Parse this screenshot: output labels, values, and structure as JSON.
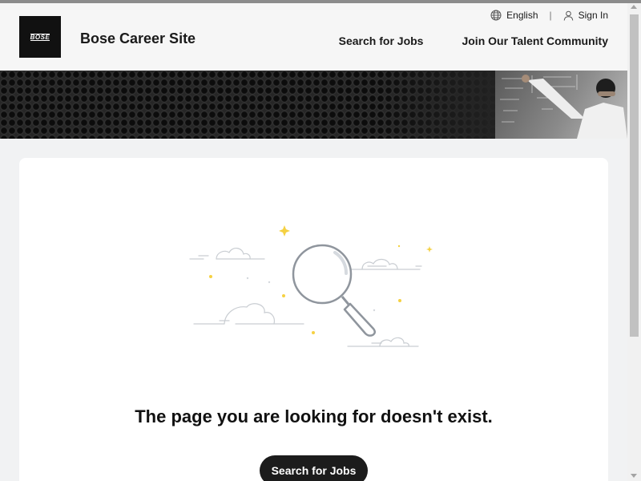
{
  "header": {
    "logo_text": "BOSE",
    "site_title": "Bose Career Site",
    "language_label": "English",
    "sign_in_label": "Sign In",
    "separator": "|",
    "nav": {
      "search_jobs": "Search for Jobs",
      "talent_community": "Join Our Talent Community"
    }
  },
  "main": {
    "message": "The page you are looking for doesn't exist.",
    "cta_label": "Search for Jobs"
  },
  "colors": {
    "header_bg": "#f6f6f6",
    "page_bg": "#f1f2f3",
    "card_bg": "#ffffff",
    "button_bg": "#1c1c1c",
    "sparkle": "#f5d142",
    "illustration_stroke": "#9aa0a8"
  },
  "icons": {
    "language": "globe-icon",
    "sign_in": "user-icon",
    "illustration": "magnifying-glass-illustration"
  }
}
